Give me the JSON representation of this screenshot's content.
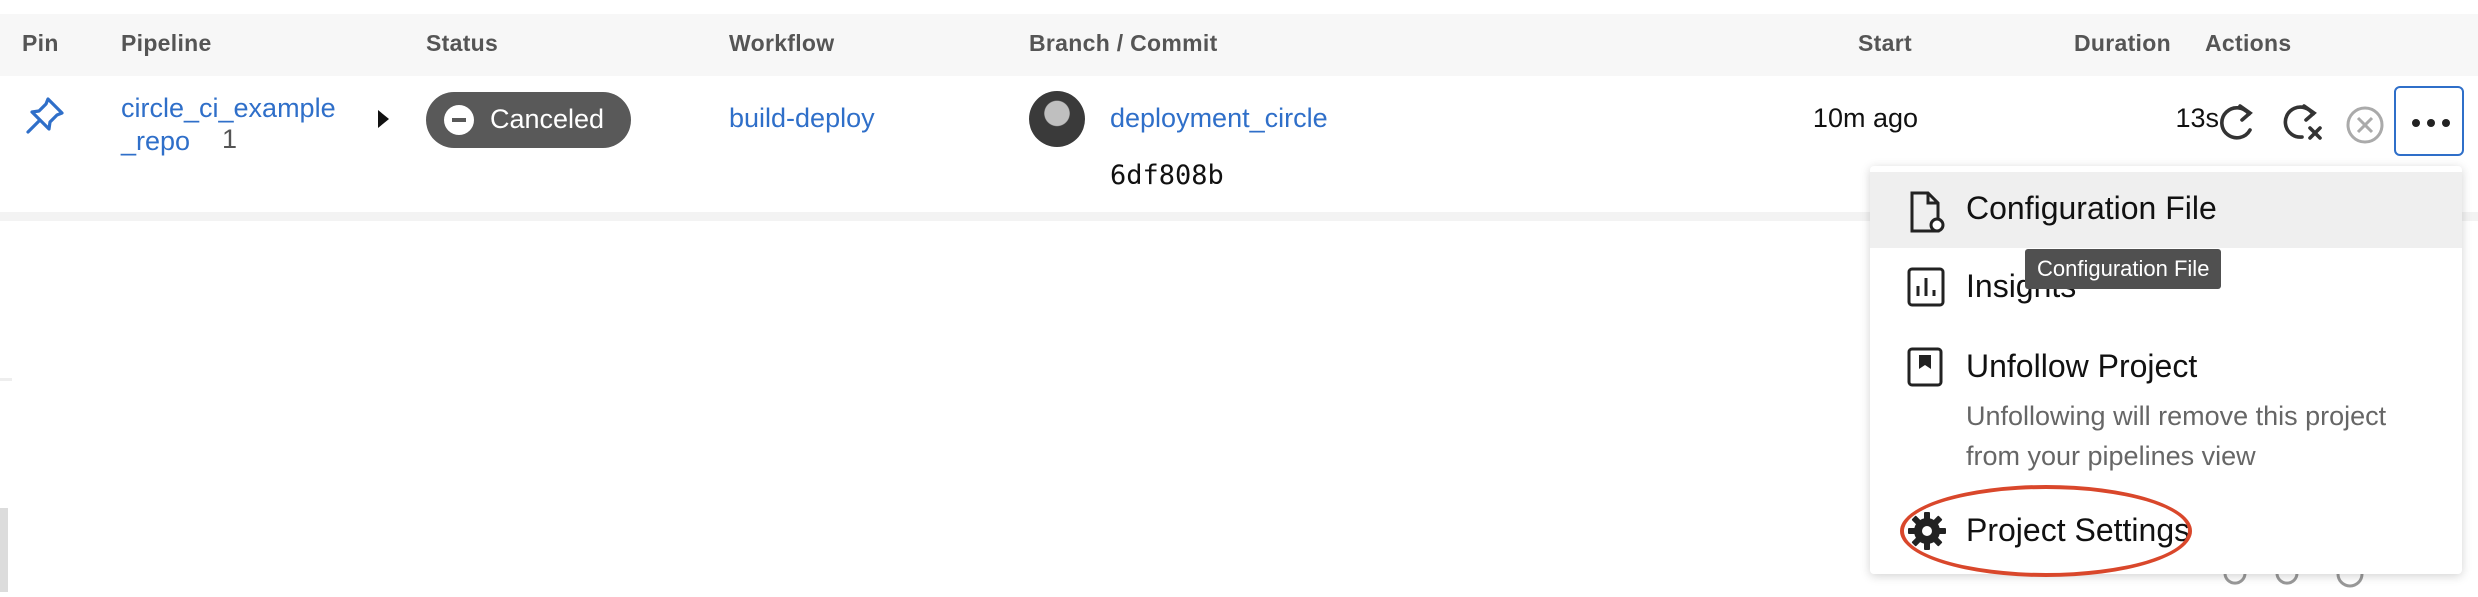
{
  "table": {
    "headers": {
      "pin": "Pin",
      "pipeline": "Pipeline",
      "status": "Status",
      "workflow": "Workflow",
      "branch_commit": "Branch / Commit",
      "start": "Start",
      "duration": "Duration",
      "actions": "Actions"
    },
    "row": {
      "pipeline_name": "circle_ci_example_repo",
      "pipeline_number": "1",
      "status": "Canceled",
      "workflow": "build-deploy",
      "branch": "deployment_circle",
      "commit": "6df808b",
      "start": "10m ago",
      "duration": "13s"
    }
  },
  "icons": {
    "pin": "pin-icon",
    "rerun": "rerun-icon",
    "rerun_failed": "rerun-failed-icon",
    "cancel": "cancel-icon",
    "more": "more-icon"
  },
  "menu": {
    "items": [
      {
        "label": "Configuration File",
        "icon": "config-file-icon"
      },
      {
        "label": "Insights",
        "icon": "insights-icon"
      },
      {
        "label": "Unfollow Project",
        "icon": "bookmark-icon",
        "description": "Unfollowing will remove this project from your pipelines view"
      },
      {
        "label": "Project Settings",
        "icon": "gear-icon"
      }
    ]
  },
  "tooltip": "Configuration File",
  "colors": {
    "link": "#2f6fc9",
    "status_canceled": "#595959",
    "annotation": "#d9472b"
  }
}
